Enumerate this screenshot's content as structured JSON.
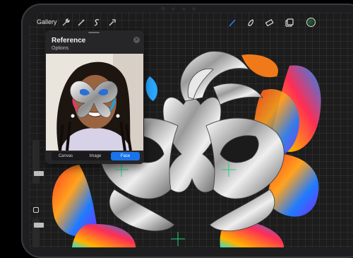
{
  "toolbar": {
    "gallery_label": "Gallery",
    "left_icons": [
      "wrench-icon",
      "magic-wand-icon",
      "selection-s-icon",
      "arrow-cursor-icon"
    ],
    "right_icons": [
      "brush-icon",
      "smudge-icon",
      "eraser-icon",
      "layers-icon",
      "color-icon"
    ],
    "active_tool_color": "#2f7cf6"
  },
  "reference": {
    "title": "Reference",
    "options_label": "Options",
    "close_icon": "close-icon",
    "tabs": [
      "Canvas",
      "Image",
      "Face"
    ],
    "active_tab": "Face",
    "accent": "#1a73e8"
  },
  "sidebar": {
    "brush_size": 0.35,
    "opacity": 1.0,
    "modify_button_icon": "square-icon"
  }
}
